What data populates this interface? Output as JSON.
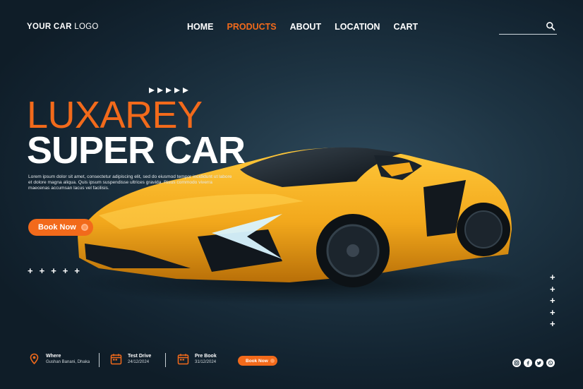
{
  "header": {
    "logo_bold": "YOUR CAR",
    "logo_thin": " LOGO",
    "nav": [
      "HOME",
      "PRODUCTS",
      "ABOUT",
      "LOCATION",
      "CART"
    ],
    "active_nav": "PRODUCTS",
    "search_placeholder": ""
  },
  "hero": {
    "title_line1": "LUXAREY",
    "title_line2": "SUPER CAR",
    "description": "Lorem ipsum dolor sit amet, consectetur adipiscing elit, sed do eiusmod tempor incididunt ut labore et dolore magna aliqua. Quis ipsum suspendisse ultrices gravida. Risus commodo viverra maecenas accumsan lacus vel facilisis.",
    "book_button": "Book Now"
  },
  "footer": {
    "where_label": "Where",
    "where_value": "Gushan Banani, Dhaka",
    "test_drive_label": "Test Drive",
    "test_drive_value": "24/12/2024",
    "pre_book_label": "Pre Book",
    "pre_book_value": "31/12/2024",
    "book_button": "Book Now",
    "social": [
      "instagram-icon",
      "facebook-icon",
      "twitter-icon",
      "whatsapp-icon"
    ]
  },
  "colors": {
    "accent": "#f26a1b",
    "car_body": "#f2a81c",
    "background": "#1d3342"
  }
}
